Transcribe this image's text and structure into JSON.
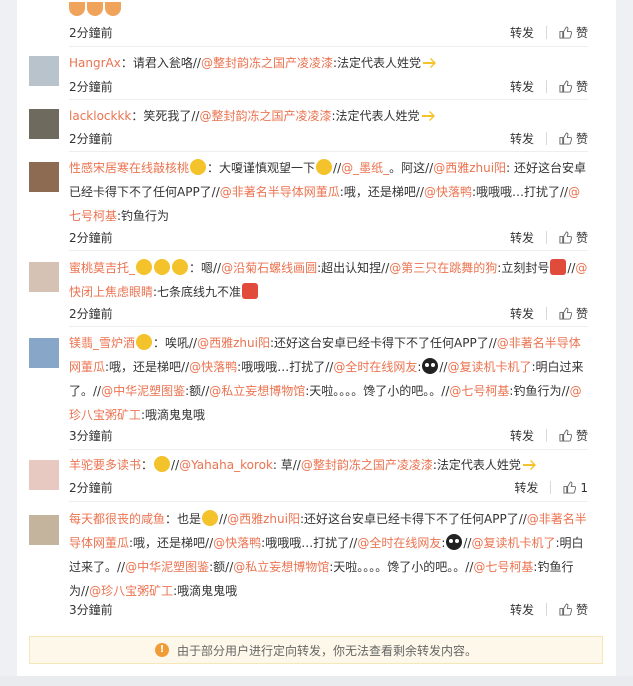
{
  "actions": {
    "repost": "转发",
    "like": "赞"
  },
  "items": [
    {
      "time": "2分鐘前",
      "likes": ""
    },
    {
      "user": "HangrAx",
      "text": "：请君入瓮咯//",
      "mentions": [
        "@整封韵冻之国产凌凌漆",
        "法定代表人姓党"
      ],
      "time": "2分鐘前",
      "likes": ""
    },
    {
      "user": "lacklockkk",
      "text": "：笑死我了//",
      "mentions": [
        "@整封韵冻之国产凌凌漆",
        "法定代表人姓党"
      ],
      "time": "2分鐘前",
      "likes": ""
    },
    {
      "user": "性感宋居寒在线敲核桃",
      "time": "2分鐘前",
      "likes": ""
    },
    {
      "user": "蜜桃莫吉托_",
      "time": "2分鐘前",
      "likes": ""
    },
    {
      "user": "镁翡_雪炉酒",
      "time": "3分鐘前",
      "likes": ""
    },
    {
      "user": "羊驼要多读书",
      "time": "2分鐘前",
      "likes": "1"
    },
    {
      "user": "每天都很丧的咸鱼",
      "time": "3分鐘前",
      "likes": ""
    }
  ],
  "c4": {
    "a": "：大嗄谨慎观望一下",
    "m1": "@_墨纸_",
    "b": "。阿这//",
    "m2": "@西雅zhui阳",
    "c": ": 还好这台安卓已经卡得下不了任何APP了//",
    "m3": "@非著名半导体网董瓜",
    "d": ":哦，还是梯吧//",
    "m4": "@快落鸭",
    "e": ":哦哦哦…打扰了//",
    "m5": "@七号柯基",
    "f": ":钓鱼行为"
  },
  "c5": {
    "a": "：嗯//",
    "m1": "@沿菊石螺线画圆",
    "b": ":超出认知捏//",
    "m2": "@第三只在跳舞的狗",
    "c": ":立刻封号",
    "m3": "@快闭上焦虑眼睛",
    "d": ":七条底线九不准"
  },
  "c6": {
    "a": "：唉吼//",
    "m1": "@西雅zhui阳",
    "b": ":还好这台安卓已经卡得下不了任何APP了//",
    "m2": "@非著名半导体网董瓜",
    "c": ":哦，还是梯吧//",
    "m3": "@快落鸭",
    "d": ":哦哦哦…打扰了//",
    "m4": "@全时在线网友",
    "e": "//",
    "m5": "@复读机卡机了",
    "f": ":明白过来了。//",
    "m6": "@中华泥塑图鉴",
    "g": ":额//",
    "m7": "@私立妄想博物馆",
    "h": ":天啦。。。。馋了小的吧。。//",
    "m8": "@七号柯基",
    "i": ":钓鱼行为//",
    "m9": "@珍八宝粥矿工",
    "j": ":哦滴鬼鬼哦"
  },
  "c7": {
    "a": "：//",
    "m1": "@Yahaha_korok",
    "b": ": 草//",
    "m2": "@整封韵冻之国产凌凌漆",
    "c": ":法定代表人姓党"
  },
  "c8": {
    "a": "：也是",
    "m1": "@西雅zhui阳",
    "b": ":还好这台安卓已经卡得下不了任何APP了//",
    "m2": "@非著名半导体网董瓜",
    "c": ":哦，还是梯吧//",
    "m3": "@快落鸭",
    "d": ":哦哦哦…打扰了//",
    "m4": "@全时在线网友",
    "e": "//",
    "m5": "@复读机卡机了",
    "f": ":明白过来了。//",
    "m6": "@中华泥塑图鉴",
    "g": ":额//",
    "m7": "@私立妄想博物馆",
    "h": ":天啦。。。。馋了小的吧。。//",
    "m8": "@七号柯基",
    "i": ":钓鱼行为//",
    "m9": "@珍八宝粥矿工",
    "j": ":哦滴鬼鬼哦"
  },
  "notice": "由于部分用户进行定向转发，你无法查看剩余转发内容。",
  "colors": {
    "link": "#eb7350",
    "notice_bg": "#fdf8e9"
  }
}
